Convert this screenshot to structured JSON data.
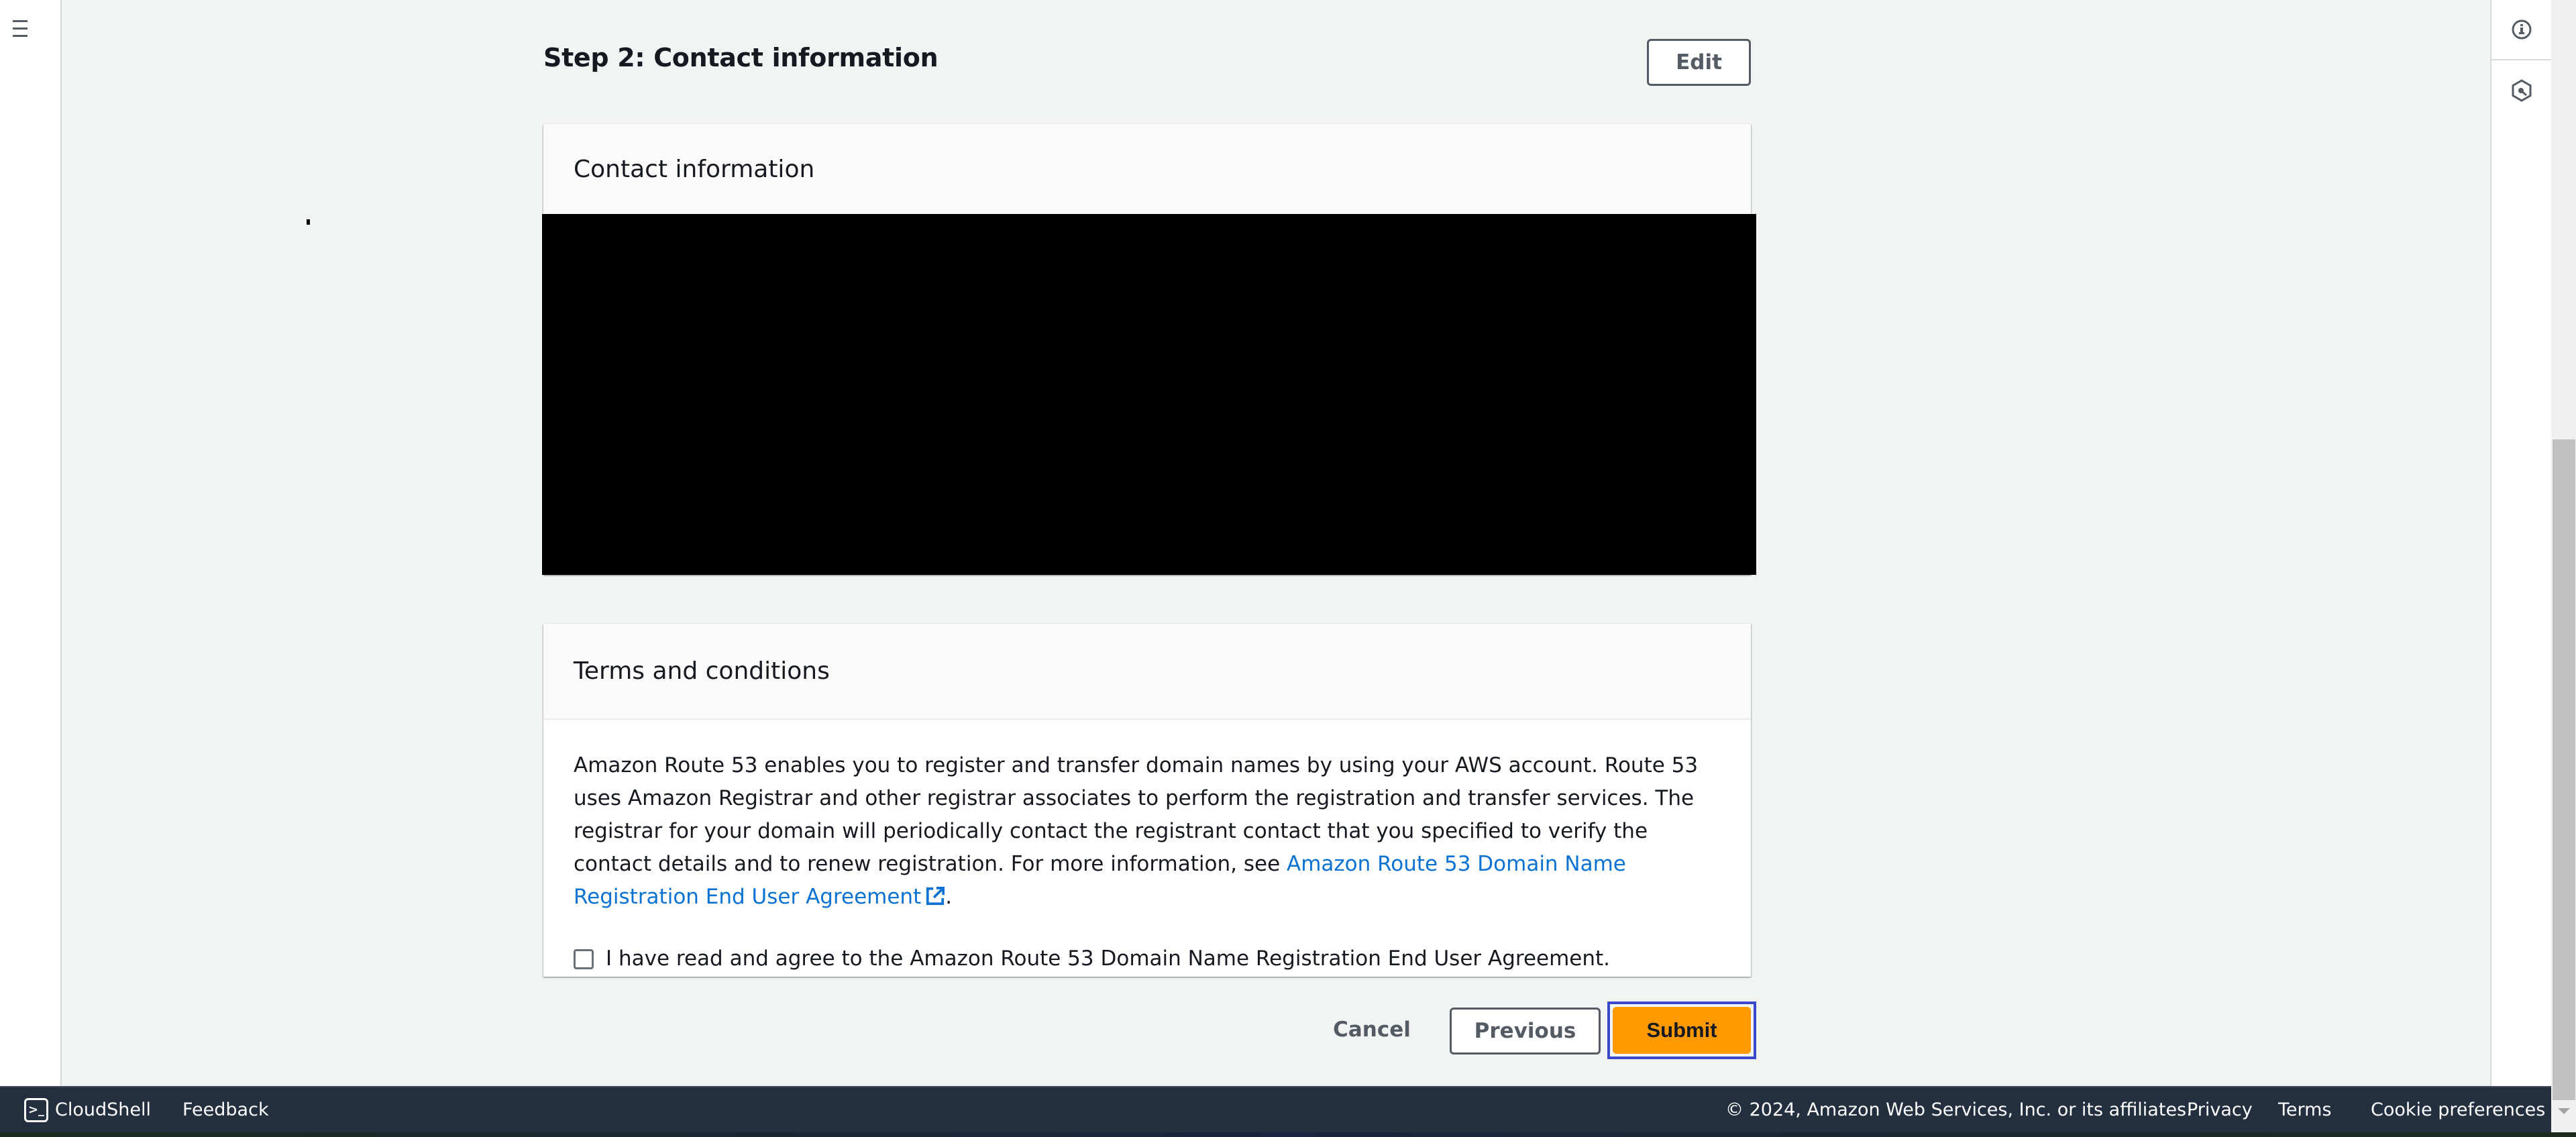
{
  "left_nav": {
    "menu_icon": "hamburger-menu-icon"
  },
  "right_panel": {
    "icons": [
      "info-icon",
      "hexagon-key-icon"
    ]
  },
  "step": {
    "title": "Step 2: Contact information",
    "edit_label": "Edit"
  },
  "contact_card": {
    "title": "Contact information",
    "content": "[redacted]"
  },
  "terms_card": {
    "title": "Terms and conditions",
    "body_text": "Amazon Route 53 enables you to register and transfer domain names by using your AWS account. Route 53 uses Amazon Registrar and other registrar associates to perform the registration and transfer services. The registrar for your domain will periodically contact the registrant contact that you specified to verify the contact details and to renew registration. For more information, see ",
    "link_text": "Amazon Route 53 Domain Name Registration End User Agreement",
    "link_icon": "external-link-icon",
    "body_suffix": ".",
    "agree_label": "I have read and agree to the Amazon Route 53 Domain Name Registration End User Agreement.",
    "agree_checked": false
  },
  "actions": {
    "cancel_label": "Cancel",
    "previous_label": "Previous",
    "submit_label": "Submit"
  },
  "footer": {
    "cloudshell_label": "CloudShell",
    "feedback_label": "Feedback",
    "copyright": "© 2024, Amazon Web Services, Inc. or its affiliates.",
    "privacy_label": "Privacy",
    "terms_label": "Terms",
    "cookie_label": "Cookie preferences"
  },
  "colors": {
    "accent_orange": "#ff9900",
    "link_blue": "#0972d3",
    "footer_bg": "#232f3e",
    "focus_ring": "#3b48cc"
  }
}
